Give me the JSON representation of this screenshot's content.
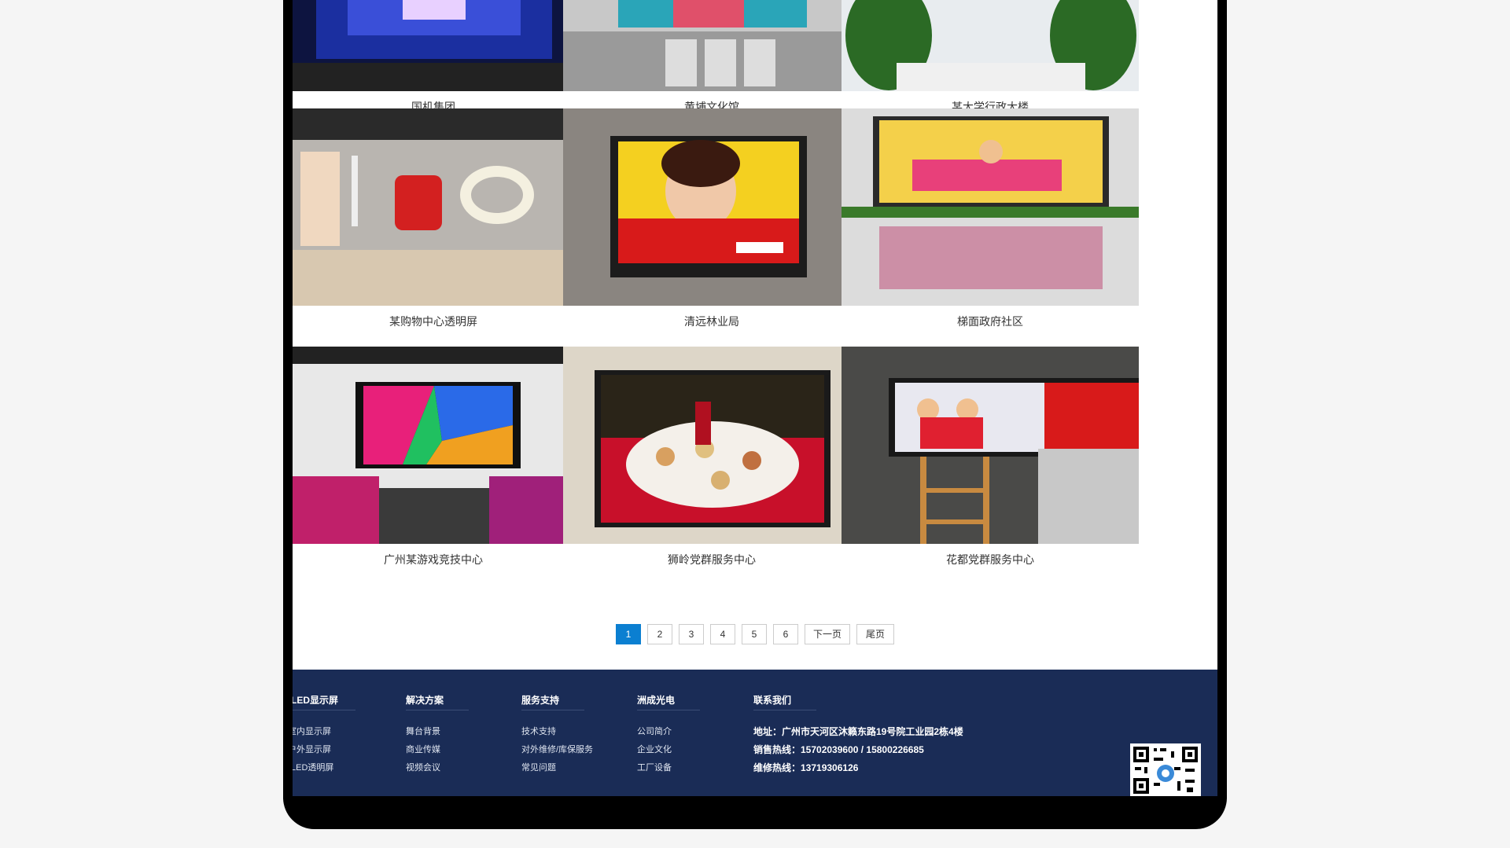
{
  "cases": [
    {
      "caption": "国机集团"
    },
    {
      "caption": "黄埔文化馆"
    },
    {
      "caption": "某大学行政大楼"
    },
    {
      "caption": "某购物中心透明屏"
    },
    {
      "caption": "清远林业局"
    },
    {
      "caption": "梯面政府社区"
    },
    {
      "caption": "广州某游戏竞技中心"
    },
    {
      "caption": "狮岭党群服务中心"
    },
    {
      "caption": "花都党群服务中心"
    }
  ],
  "pagination": {
    "pages": [
      "1",
      "2",
      "3",
      "4",
      "5",
      "6"
    ],
    "current": "1",
    "next_label": "下一页",
    "last_label": "尾页"
  },
  "footer": {
    "columns": [
      {
        "title": "LED显示屏",
        "links": [
          "室内显示屏",
          "户外显示屏",
          "LED透明屏"
        ]
      },
      {
        "title": "解决方案",
        "links": [
          "舞台背景",
          "商业传媒",
          "视频会议"
        ]
      },
      {
        "title": "服务支持",
        "links": [
          "技术支持",
          "对外维修/库保服务",
          "常见问题"
        ]
      },
      {
        "title": "洲成光电",
        "links": [
          "公司简介",
          "企业文化",
          "工厂设备"
        ]
      },
      {
        "title": "联系我们",
        "links": []
      }
    ],
    "contact": {
      "address": "地址：广州市天河区沐籁东路19号院工业园2栋4楼",
      "sales": "销售热线：15702039600 / 15800226685",
      "service": "维修热线：13719306126"
    }
  },
  "colors": {
    "accent": "#0b7fd1",
    "footer_bg": "#1a2c56"
  }
}
